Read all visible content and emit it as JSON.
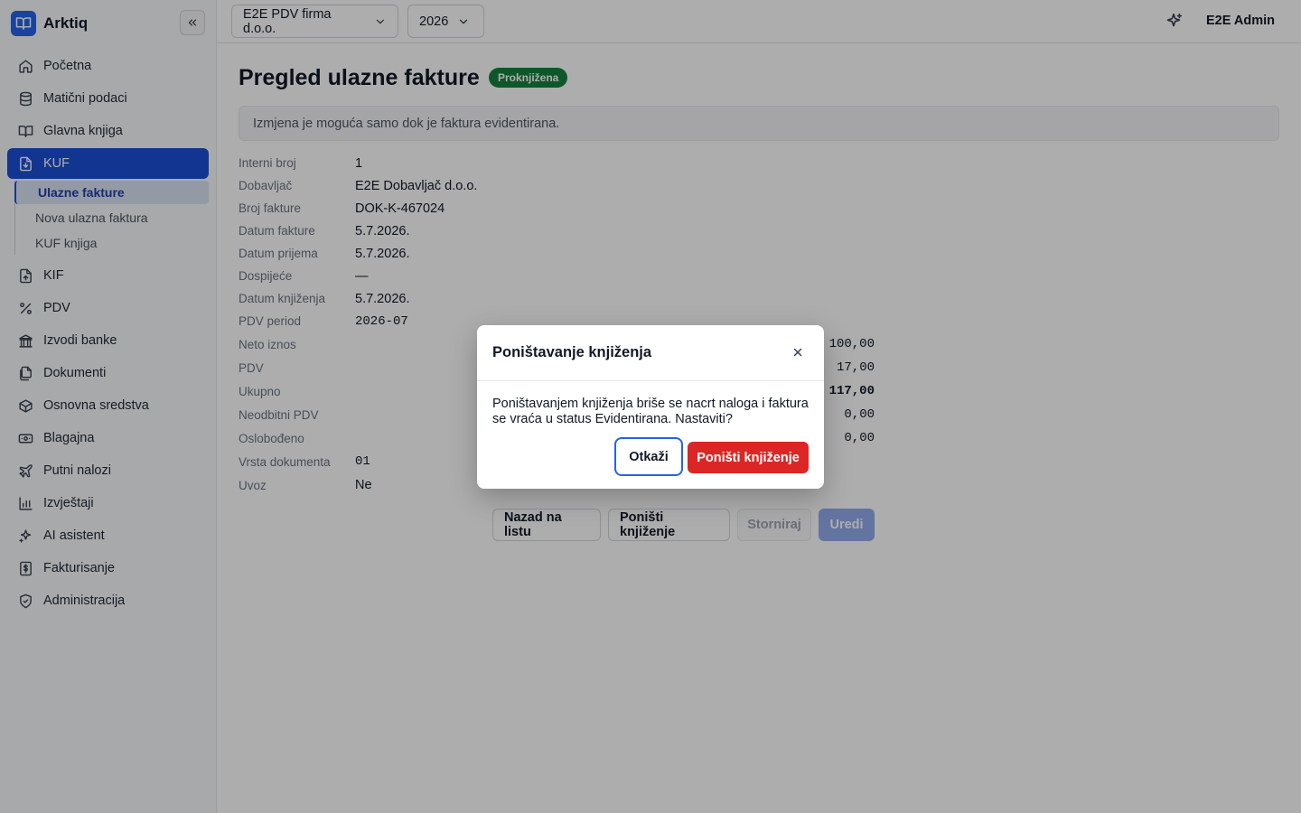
{
  "app": {
    "name": "Arktiq"
  },
  "sidebar": {
    "items": [
      {
        "label": "Početna",
        "icon": "home-icon"
      },
      {
        "label": "Matični podaci",
        "icon": "database-icon"
      },
      {
        "label": "Glavna knjiga",
        "icon": "book-icon"
      },
      {
        "label": "KUF",
        "icon": "file-download-icon",
        "active": true
      },
      {
        "label": "KIF",
        "icon": "file-upload-icon"
      },
      {
        "label": "PDV",
        "icon": "percent-icon"
      },
      {
        "label": "Izvodi banke",
        "icon": "bank-icon"
      },
      {
        "label": "Dokumenti",
        "icon": "documents-icon"
      },
      {
        "label": "Osnovna sredstva",
        "icon": "box-icon"
      },
      {
        "label": "Blagajna",
        "icon": "cash-icon"
      },
      {
        "label": "Putni nalozi",
        "icon": "plane-icon"
      },
      {
        "label": "Izvještaji",
        "icon": "bar-chart-icon"
      },
      {
        "label": "AI asistent",
        "icon": "sparkle-icon"
      },
      {
        "label": "Fakturisanje",
        "icon": "invoice-dollar-icon"
      },
      {
        "label": "Administracija",
        "icon": "shield-icon"
      }
    ],
    "kuf_sub": [
      {
        "label": "Ulazne fakture",
        "active": true
      },
      {
        "label": "Nova ulazna faktura"
      },
      {
        "label": "KUF knjiga"
      }
    ]
  },
  "topbar": {
    "company": "E2E PDV firma d.o.o.",
    "year": "2026",
    "user": "E2E Admin"
  },
  "page": {
    "title": "Pregled ulazne fakture",
    "status": "Proknjižena",
    "notice": "Izmjena je moguća samo dok je faktura evidentirana."
  },
  "fields": {
    "interni_broj": {
      "label": "Interni broj",
      "value": "1"
    },
    "dobavljac": {
      "label": "Dobavljač",
      "value": "E2E Dobavljač d.o.o."
    },
    "broj_fakture": {
      "label": "Broj fakture",
      "value": "DOK-K-467024"
    },
    "datum_fakture": {
      "label": "Datum fakture",
      "value": "5.7.2026."
    },
    "datum_prijema": {
      "label": "Datum prijema",
      "value": "5.7.2026."
    },
    "dospijece": {
      "label": "Dospijeće",
      "value": "—"
    },
    "datum_knjizenja": {
      "label": "Datum knjiženja",
      "value": "5.7.2026."
    },
    "pdv_period": {
      "label": "PDV period",
      "value": "2026-07"
    },
    "neto_iznos": {
      "label": "Neto iznos",
      "value": "100,00"
    },
    "pdv": {
      "label": "PDV",
      "value": "17,00"
    },
    "ukupno": {
      "label": "Ukupno",
      "value": "117,00"
    },
    "neodbitni_pdv": {
      "label": "Neodbitni PDV",
      "value": "0,00"
    },
    "oslobodjeno": {
      "label": "Oslobođeno",
      "value": "0,00"
    },
    "vrsta_dokumenta": {
      "label": "Vrsta dokumenta",
      "value": "01"
    },
    "uvoz": {
      "label": "Uvoz",
      "value": "Ne"
    }
  },
  "actions": {
    "back": "Nazad na listu",
    "unpost": "Poništi knjiženje",
    "storno": "Storniraj",
    "edit": "Uredi"
  },
  "modal": {
    "title": "Poništavanje knjiženja",
    "body": "Poništavanjem knjiženja briše se nacrt naloga i faktura se vraća u status Evidentirana. Nastaviti?",
    "cancel": "Otkaži",
    "confirm": "Poništi knjiženje"
  },
  "colors": {
    "accent": "#1d4ed8",
    "status_green": "#15803d",
    "danger": "#dc2626"
  }
}
